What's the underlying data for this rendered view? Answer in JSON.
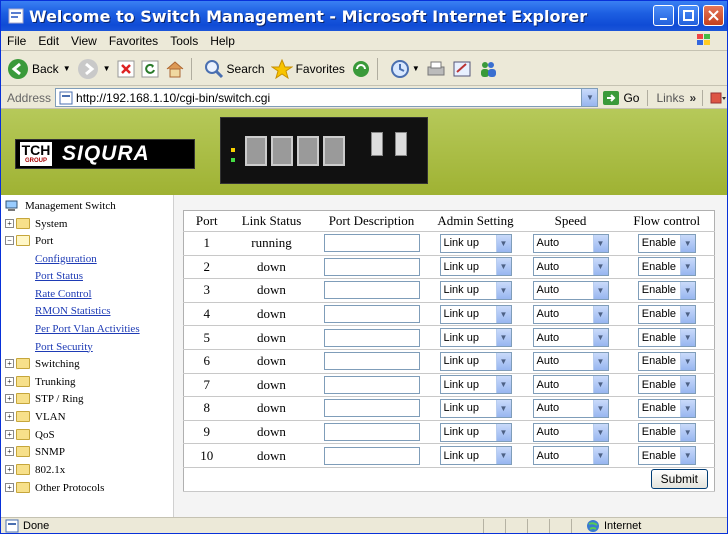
{
  "window": {
    "title": "Welcome to Switch Management - Microsoft Internet Explorer"
  },
  "menu": [
    "File",
    "Edit",
    "View",
    "Favorites",
    "Tools",
    "Help"
  ],
  "toolbar": {
    "back": "Back",
    "search": "Search",
    "favorites": "Favorites"
  },
  "address": {
    "label": "Address",
    "url": "http://192.168.1.10/cgi-bin/switch.cgi",
    "go": "Go",
    "links": "Links"
  },
  "banner": {
    "logo_text": "SIQURA",
    "badge_top": "TCH",
    "badge_bottom": "GROUP"
  },
  "sidebar": {
    "root": "Management Switch",
    "items": [
      {
        "label": "System",
        "expanded": false
      },
      {
        "label": "Port",
        "expanded": true,
        "children": [
          "Configuration",
          "Port Status",
          "Rate Control",
          "RMON Statistics",
          "Per Port Vlan Activities",
          "Port Security"
        ]
      },
      {
        "label": "Switching",
        "expanded": false
      },
      {
        "label": "Trunking",
        "expanded": false
      },
      {
        "label": "STP / Ring",
        "expanded": false
      },
      {
        "label": "VLAN",
        "expanded": false
      },
      {
        "label": "QoS",
        "expanded": false
      },
      {
        "label": "SNMP",
        "expanded": false
      },
      {
        "label": "802.1x",
        "expanded": false
      },
      {
        "label": "Other Protocols",
        "expanded": false
      }
    ]
  },
  "table": {
    "headers": [
      "Port",
      "Link Status",
      "Port Description",
      "Admin Setting",
      "Speed",
      "Flow control"
    ],
    "rows": [
      {
        "port": "1",
        "status": "running",
        "admin": "Link up",
        "speed": "Auto",
        "flow": "Enable"
      },
      {
        "port": "2",
        "status": "down",
        "admin": "Link up",
        "speed": "Auto",
        "flow": "Enable"
      },
      {
        "port": "3",
        "status": "down",
        "admin": "Link up",
        "speed": "Auto",
        "flow": "Enable"
      },
      {
        "port": "4",
        "status": "down",
        "admin": "Link up",
        "speed": "Auto",
        "flow": "Enable"
      },
      {
        "port": "5",
        "status": "down",
        "admin": "Link up",
        "speed": "Auto",
        "flow": "Enable"
      },
      {
        "port": "6",
        "status": "down",
        "admin": "Link up",
        "speed": "Auto",
        "flow": "Enable"
      },
      {
        "port": "7",
        "status": "down",
        "admin": "Link up",
        "speed": "Auto",
        "flow": "Enable"
      },
      {
        "port": "8",
        "status": "down",
        "admin": "Link up",
        "speed": "Auto",
        "flow": "Enable"
      },
      {
        "port": "9",
        "status": "down",
        "admin": "Link up",
        "speed": "Auto",
        "flow": "Enable"
      },
      {
        "port": "10",
        "status": "down",
        "admin": "Link up",
        "speed": "Auto",
        "flow": "Enable"
      }
    ],
    "submit": "Submit"
  },
  "status": {
    "left": "Done",
    "zone": "Internet"
  },
  "colors": {
    "titlebar": "#1d5fe2",
    "banner": "#a8bb3c",
    "link": "#1e3bb5"
  }
}
